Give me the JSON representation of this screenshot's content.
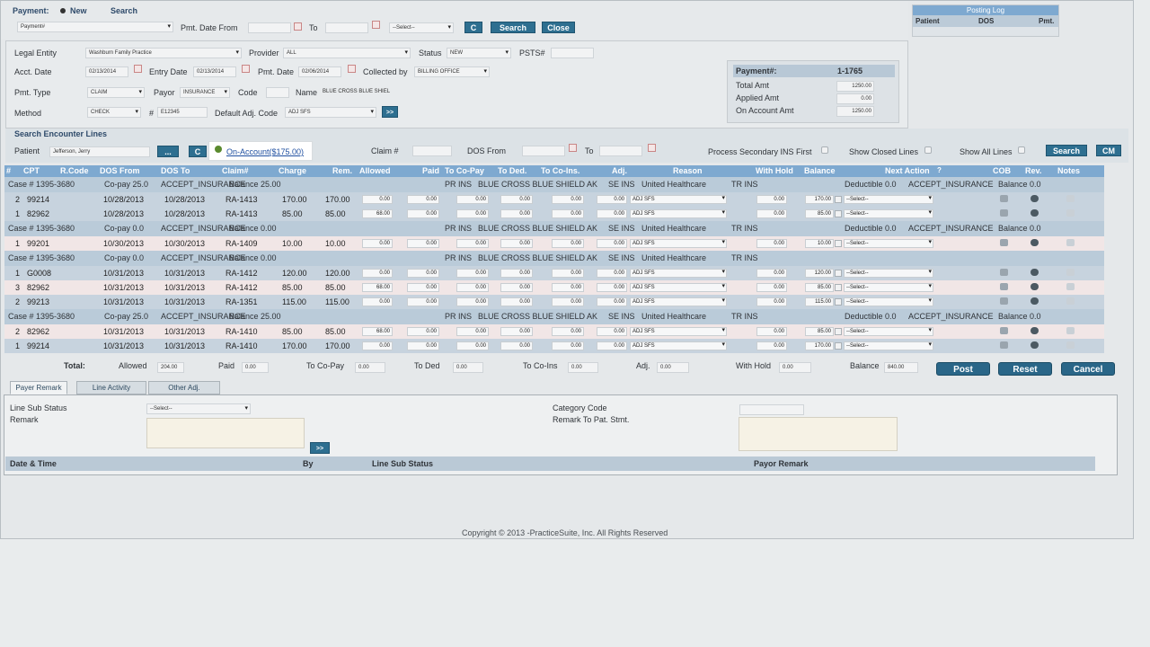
{
  "top": {
    "payment_label": "Payment:",
    "new_label": "New",
    "search_label": "Search",
    "payment_num_placeholder": "Payment#",
    "pmt_date_from_label": "Pmt. Date From",
    "to_label": "To",
    "select_placeholder": "--Select--",
    "c_label": "C",
    "search_btn": "Search",
    "close_btn": "Close"
  },
  "posting_log": {
    "title": "Posting Log",
    "col_patient": "Patient",
    "col_dos": "DOS",
    "col_pmt": "Pmt."
  },
  "form": {
    "legal_entity_label": "Legal Entity",
    "legal_entity_value": "Washburn Family Practice",
    "provider_label": "Provider",
    "provider_value": "ALL",
    "status_label": "Status",
    "status_value": "NEW",
    "psts_label": "PSTS#",
    "acct_date_label": "Acct. Date",
    "acct_date_value": "02/13/2014",
    "entry_date_label": "Entry Date",
    "entry_date_value": "02/13/2014",
    "pmt_date_label": "Pmt. Date",
    "pmt_date_value": "02/06/2014",
    "collected_by_label": "Collected by",
    "collected_by_value": "BILLING OFFICE",
    "pmt_type_label": "Pmt. Type",
    "pmt_type_value": "CLAIM",
    "payor_label": "Payor",
    "payor_value": "INSURANCE",
    "code_label": "Code",
    "name_label": "Name",
    "name_value": "BLUE CROSS BLUE SHIEL",
    "method_label": "Method",
    "method_value": "CHECK",
    "hash_label": "#",
    "check_value": "E12345",
    "default_adj_label": "Default Adj. Code",
    "default_adj_value": "ADJ SFS",
    "arrow_btn": ">>"
  },
  "summary": {
    "payment_label": "Payment#:",
    "payment_value": "1-1765",
    "total_label": "Total Amt",
    "total_value": "1250.00",
    "applied_label": "Applied Amt",
    "applied_value": "0.00",
    "on_account_label": "On Account Amt",
    "on_account_value": "1250.00"
  },
  "search_enc": {
    "title": "Search Encounter Lines",
    "patient_label": "Patient",
    "patient_value": "Jefferson, Jerry",
    "dots_btn": "...",
    "c_btn": "C",
    "on_account_link": "On-Account($175.00)",
    "claim_label": "Claim #",
    "dos_from_label": "DOS From",
    "to_label": "To",
    "process_secondary": "Process Secondary INS First",
    "show_closed": "Show Closed Lines",
    "show_all": "Show All Lines",
    "search_btn": "Search",
    "cm_btn": "CM"
  },
  "grid": {
    "headers": [
      "#",
      "CPT",
      "R.Code",
      "DOS From",
      "DOS To",
      "Claim#",
      "Charge",
      "Rem.",
      "Allowed",
      "Paid",
      "To Co-Pay",
      "To Ded.",
      "To Co-Ins.",
      "Adj.",
      "Reason",
      "With Hold",
      "Balance",
      "Next Action",
      "COB",
      "Rev.",
      "Notes"
    ],
    "rows": [
      {
        "kind": "case",
        "case_no": "Case #   1395-3680",
        "copay": "Co-pay  25.0",
        "insurance": "ACCEPT_INSURANCE",
        "balance": "Balance  25.00",
        "pr": "PR INS",
        "payer": "BLUE CROSS BLUE SHIELD AK",
        "se": "SE INS",
        "uh": "United Healthcare",
        "tr": "TR INS",
        "deductible": "Deductible  0.0",
        "next": "ACCEPT_INSURANCE",
        "bal2": "Balance  0.0"
      },
      {
        "kind": "line",
        "shade": "a",
        "num": "2",
        "cpt": "99214",
        "dos_from": "10/28/2013",
        "dos_to": "10/28/2013",
        "claim": "RA-1413",
        "charge": "170.00",
        "rem": "170.00",
        "allowed": "0.00",
        "paid": "0.00",
        "copay": "0.00",
        "ded": "0.00",
        "coins": "0.00",
        "adj": "0.00",
        "reason": "ADJ SFS",
        "withhold": "0.00",
        "balance": "170.00",
        "next": "--Select--"
      },
      {
        "kind": "line",
        "shade": "a",
        "num": "1",
        "cpt": "82962",
        "dos_from": "10/28/2013",
        "dos_to": "10/28/2013",
        "claim": "RA-1413",
        "charge": "85.00",
        "rem": "85.00",
        "allowed": "68.00",
        "paid": "0.00",
        "copay": "0.00",
        "ded": "0.00",
        "coins": "0.00",
        "adj": "0.00",
        "reason": "ADJ SFS",
        "withhold": "0.00",
        "balance": "85.00",
        "next": "--Select--"
      },
      {
        "kind": "case",
        "case_no": "Case #   1395-3680",
        "copay": "Co-pay  0.0",
        "insurance": "ACCEPT_INSURANCE",
        "balance": "Balance  0.00",
        "pr": "PR INS",
        "payer": "BLUE CROSS BLUE SHIELD AK",
        "se": "SE INS",
        "uh": "United Healthcare",
        "tr": "TR INS",
        "deductible": "Deductible  0.0",
        "next": "ACCEPT_INSURANCE",
        "bal2": "Balance  0.0"
      },
      {
        "kind": "line",
        "shade": "b",
        "num": "1",
        "cpt": "99201",
        "dos_from": "10/30/2013",
        "dos_to": "10/30/2013",
        "claim": "RA-1409",
        "charge": "10.00",
        "rem": "10.00",
        "allowed": "0.00",
        "paid": "0.00",
        "copay": "0.00",
        "ded": "0.00",
        "coins": "0.00",
        "adj": "0.00",
        "reason": "ADJ SFS",
        "withhold": "0.00",
        "balance": "10.00",
        "next": "--Select--"
      },
      {
        "kind": "case",
        "case_no": "Case #   1395-3680",
        "copay": "Co-pay  0.0",
        "insurance": "ACCEPT_INSURANCE",
        "balance": "Balance  0.00",
        "pr": "PR INS",
        "payer": "BLUE CROSS BLUE SHIELD AK",
        "se": "SE INS",
        "uh": "United Healthcare",
        "tr": "TR INS",
        "deductible": "",
        "next": "",
        "bal2": ""
      },
      {
        "kind": "line",
        "shade": "a",
        "num": "1",
        "cpt": "G0008",
        "dos_from": "10/31/2013",
        "dos_to": "10/31/2013",
        "claim": "RA-1412",
        "charge": "120.00",
        "rem": "120.00",
        "allowed": "0.00",
        "paid": "0.00",
        "copay": "0.00",
        "ded": "0.00",
        "coins": "0.00",
        "adj": "0.00",
        "reason": "ADJ SFS",
        "withhold": "0.00",
        "balance": "120.00",
        "next": "--Select--"
      },
      {
        "kind": "line",
        "shade": "b",
        "num": "3",
        "cpt": "82962",
        "dos_from": "10/31/2013",
        "dos_to": "10/31/2013",
        "claim": "RA-1412",
        "charge": "85.00",
        "rem": "85.00",
        "allowed": "68.00",
        "paid": "0.00",
        "copay": "0.00",
        "ded": "0.00",
        "coins": "0.00",
        "adj": "0.00",
        "reason": "ADJ SFS",
        "withhold": "0.00",
        "balance": "85.00",
        "next": "--Select--"
      },
      {
        "kind": "line",
        "shade": "a",
        "num": "2",
        "cpt": "99213",
        "dos_from": "10/31/2013",
        "dos_to": "10/31/2013",
        "claim": "RA-1351",
        "charge": "115.00",
        "rem": "115.00",
        "allowed": "0.00",
        "paid": "0.00",
        "copay": "0.00",
        "ded": "0.00",
        "coins": "0.00",
        "adj": "0.00",
        "reason": "ADJ SFS",
        "withhold": "0.00",
        "balance": "115.00",
        "next": "--Select--"
      },
      {
        "kind": "case",
        "case_no": "Case #   1395-3680",
        "copay": "Co-pay  25.0",
        "insurance": "ACCEPT_INSURANCE",
        "balance": "Balance  25.00",
        "pr": "PR INS",
        "payer": "BLUE CROSS BLUE SHIELD AK",
        "se": "SE INS",
        "uh": "United Healthcare",
        "tr": "TR INS",
        "deductible": "Deductible  0.0",
        "next": "ACCEPT_INSURANCE",
        "bal2": "Balance  0.0"
      },
      {
        "kind": "line",
        "shade": "b",
        "num": "2",
        "cpt": "82962",
        "dos_from": "10/31/2013",
        "dos_to": "10/31/2013",
        "claim": "RA-1410",
        "charge": "85.00",
        "rem": "85.00",
        "allowed": "68.00",
        "paid": "0.00",
        "copay": "0.00",
        "ded": "0.00",
        "coins": "0.00",
        "adj": "0.00",
        "reason": "ADJ SFS",
        "withhold": "0.00",
        "balance": "85.00",
        "next": "--Select--"
      },
      {
        "kind": "line",
        "shade": "a",
        "num": "1",
        "cpt": "99214",
        "dos_from": "10/31/2013",
        "dos_to": "10/31/2013",
        "claim": "RA-1410",
        "charge": "170.00",
        "rem": "170.00",
        "allowed": "0.00",
        "paid": "0.00",
        "copay": "0.00",
        "ded": "0.00",
        "coins": "0.00",
        "adj": "0.00",
        "reason": "ADJ SFS",
        "withhold": "0.00",
        "balance": "170.00",
        "next": "--Select--"
      }
    ]
  },
  "totals": {
    "total_label": "Total:",
    "allowed_label": "Allowed",
    "allowed_value": "204.00",
    "paid_label": "Paid",
    "paid_value": "0.00",
    "copay_label": "To Co-Pay",
    "copay_value": "0.00",
    "ded_label": "To Ded",
    "ded_value": "0.00",
    "coins_label": "To Co-Ins",
    "coins_value": "0.00",
    "adj_label": "Adj.",
    "adj_value": "0.00",
    "withhold_label": "With Hold",
    "withhold_value": "0.00",
    "balance_label": "Balance",
    "balance_value": "840.00",
    "post_btn": "Post",
    "reset_btn": "Reset",
    "cancel_btn": "Cancel"
  },
  "tabs": [
    "Payer Remark",
    "Line Activity",
    "Other Adj."
  ],
  "remark": {
    "line_sub_status_label": "Line Sub Status",
    "line_sub_status_value": "--Select--",
    "remark_label": "Remark",
    "category_code_label": "Category Code",
    "remark_pat_label": "Remark To Pat. Stmt.",
    "arrow_btn": ">>",
    "col_date": "Date & Time",
    "col_by": "By",
    "col_sub": "Line Sub Status",
    "col_payor": "Payor Remark"
  },
  "footer": "Copyright © 2013 -PracticeSuite, Inc. All Rights Reserved"
}
